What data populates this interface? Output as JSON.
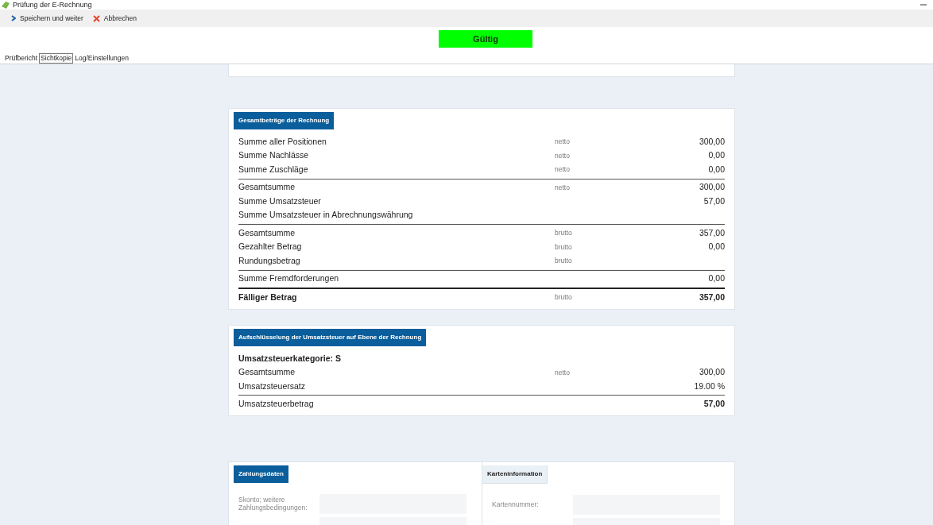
{
  "window": {
    "title": "Prüfung der E-Rechnung"
  },
  "toolbar": [
    {
      "kind": "next",
      "label": "Speichern und weiter"
    },
    {
      "kind": "cancel",
      "label": "Abbrechen"
    }
  ],
  "status_badge": "Gültig",
  "tabs": [
    {
      "label": "Prüfbericht",
      "selected": false
    },
    {
      "label": "Sichtkopie",
      "selected": true
    },
    {
      "label": "Log/Einstellungen",
      "selected": false
    }
  ],
  "totals": {
    "title": "Gesamtbeträge der Rechnung",
    "rows": [
      {
        "label": "Summe aller Positionen",
        "qualifier": "netto",
        "value": "300,00"
      },
      {
        "label": "Summe Nachlässe",
        "qualifier": "netto",
        "value": "0,00"
      },
      {
        "label": "Summe Zuschläge",
        "qualifier": "netto",
        "value": "0,00"
      },
      {
        "label": "Gesamtsumme",
        "qualifier": "netto",
        "value": "300,00",
        "rule_above": true
      },
      {
        "label": "Summe Umsatzsteuer",
        "value": "57,00"
      },
      {
        "label": "Summe Umsatzsteuer in Abrechnungswährung"
      },
      {
        "label": "Gesamtsumme",
        "qualifier": "brutto",
        "value": "357,00",
        "rule_above": true
      },
      {
        "label": "Gezahlter Betrag",
        "qualifier": "brutto",
        "value": "0,00"
      },
      {
        "label": "Rundungsbetrag",
        "qualifier": "brutto"
      },
      {
        "label": "Summe Fremdforderungen",
        "value": "0,00",
        "rule_above": true
      },
      {
        "label": "Fälliger Betrag",
        "qualifier": "brutto",
        "value": "357,00",
        "rule_above": true,
        "heavy_rule": true,
        "bold": true
      }
    ]
  },
  "vat_breakdown": {
    "title": "Aufschlüsselung der Umsatzsteuer auf Ebene der Rechnung",
    "category": "Umsatzsteuerkategorie: S",
    "rows": [
      {
        "label": "Gesamtsumme",
        "qualifier": "netto",
        "value": "300,00"
      },
      {
        "label": "Umsatzsteuersatz",
        "value": "19.00 %"
      },
      {
        "label": "Umsatzsteuerbetrag",
        "value": "57,00",
        "rule_above": true,
        "value_bold": true
      }
    ]
  },
  "payment": {
    "title": "Zahlungsdaten",
    "fields": [
      {
        "label": "Skonto; weitere Zahlungsbedingungen:"
      }
    ]
  },
  "card": {
    "title": "Karteninformation",
    "fields": [
      {
        "label": "Kartennummer:"
      }
    ]
  }
}
